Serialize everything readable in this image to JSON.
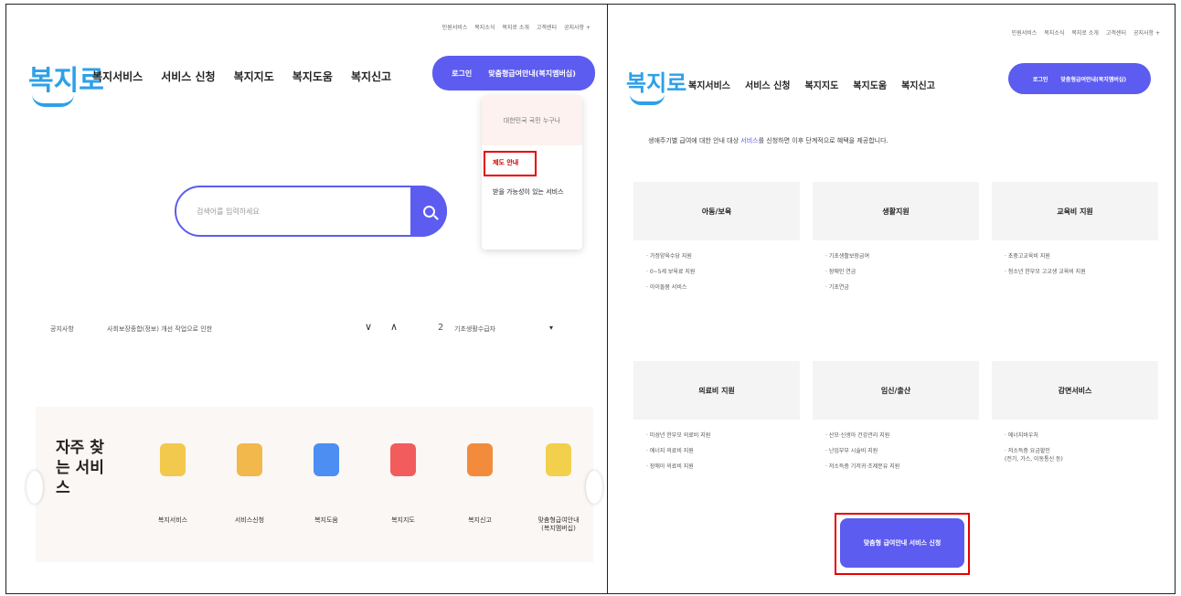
{
  "left": {
    "util_links": [
      "민원서비스",
      "복지소식",
      "복지로 소개",
      "고객센터",
      "공지사항 +"
    ],
    "logo": "복지로",
    "gnb": [
      "복지서비스",
      "서비스 신청",
      "복지지도",
      "복지도움",
      "복지신고"
    ],
    "login": {
      "label": "로그인",
      "service": "맞춤형급여안내(복지멤버십)"
    },
    "dropdown": {
      "head": "대한민국 국민 누구나",
      "item1": "제도 안내",
      "item2": "받을 가능성이 있는 서비스"
    },
    "search": {
      "placeholder": "검색어를 입력하세요"
    },
    "notice": {
      "label": "공지사항",
      "text": "사회보장종합(정보) 개선 작업으로 인한",
      "rank": "2",
      "rank_text": "기초생활수급자"
    },
    "frequent": {
      "title": "자주 찾는 서비스",
      "items": [
        {
          "label": "복지서비스",
          "color": "#f2c94c"
        },
        {
          "label": "서비스신청",
          "color": "#f2b84c"
        },
        {
          "label": "복지도움",
          "color": "#4c8ef2"
        },
        {
          "label": "복지지도",
          "color": "#f25c5c"
        },
        {
          "label": "복지신고",
          "color": "#f28c3c"
        },
        {
          "label": "맞춤형급여안내\n(복지멤버십)",
          "color": "#f2d04c"
        }
      ]
    }
  },
  "right": {
    "util_links": [
      "민원서비스",
      "복지소식",
      "복지로 소개",
      "고객센터",
      "공지사항 +"
    ],
    "logo": "복지로",
    "gnb": [
      "복지서비스",
      "서비스 신청",
      "복지지도",
      "복지도움",
      "복지신고"
    ],
    "login": {
      "label": "로그인",
      "service": "맞춤형급여안내(복지멤버십)"
    },
    "intro": {
      "pre": "생애주기별 급여에 대한 안내 대상",
      "highlight": "서비스",
      "post": "를 신청하면 이후 단계적으로 혜택을 제공합니다."
    },
    "categories": [
      {
        "title": "아동/보육",
        "items": [
          "가정양육수당 지원",
          "0~5세 보육료 지원",
          "아이돌봄 서비스"
        ]
      },
      {
        "title": "생활지원",
        "items": [
          "기초생활보장급여",
          "장애인 연금",
          "기초연금"
        ]
      },
      {
        "title": "교육비 지원",
        "items": [
          "초중고교육비 지원",
          "청소년 한부모 고교생 교육비 지원"
        ]
      },
      {
        "title": "의료비 지원",
        "items": [
          "미성년 한부모 의료비 지원",
          "에너지 의료비 지원",
          "장애아 의료비 지원"
        ]
      },
      {
        "title": "임신/출산",
        "items": [
          "산모·신생아 건강관리 지원",
          "난임부부 시술비 지원",
          "저소득층 기저귀·조제분유 지원"
        ]
      },
      {
        "title": "감면서비스",
        "items": [
          "에너지바우처",
          "저소득층 요금할인\n(전기, 가스, 이동통신 등)"
        ]
      }
    ],
    "apply_button": "맞춤형 급여안내 서비스 신청"
  }
}
